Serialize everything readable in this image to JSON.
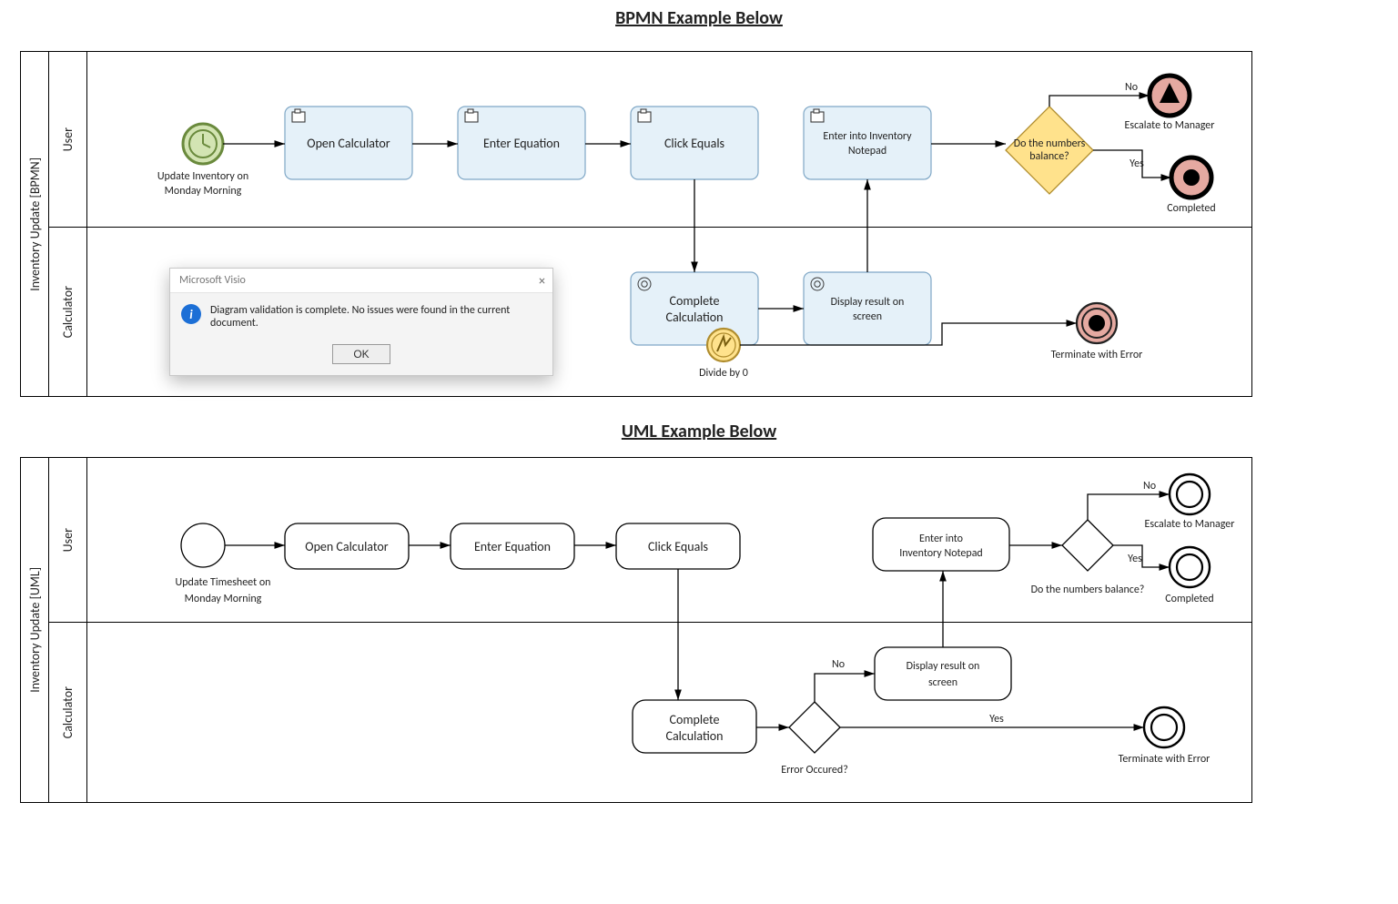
{
  "titles": {
    "bpmn": "BPMN Example Below",
    "uml": "UML Example Below"
  },
  "bpmn": {
    "pool": "Inventory Update [BPMN]",
    "lanes": {
      "user": "User",
      "calc": "Calculator"
    },
    "start_label": "Update Inventory on Monday Morning",
    "tasks": {
      "open_calc": "Open Calculator",
      "enter_eq": "Enter Equation",
      "click_equals": "Click Equals",
      "complete": "Complete Calculation",
      "display": "Display result on screen",
      "enter_inv": "Enter into Inventory Notepad"
    },
    "gateway": {
      "question_l1": "Do the numbers",
      "question_l2": "balance?",
      "yes": "Yes",
      "no": "No"
    },
    "events": {
      "divide0": "Divide by 0",
      "escalate": "Escalate to Manager",
      "completed": "Completed",
      "term_err": "Terminate with Error"
    }
  },
  "uml": {
    "pool": "Inventory Update [UML]",
    "lanes": {
      "user": "User",
      "calc": "Calculator"
    },
    "start_label": "Update Timesheet on Monday Morning",
    "tasks": {
      "open_calc": "Open Calculator",
      "enter_eq": "Enter Equation",
      "click_equals": "Click Equals",
      "complete": "Complete Calculation",
      "display": "Display result on screen",
      "enter_inv": "Enter into Inventory Notepad"
    },
    "gate_err": {
      "question": "Error Occured?",
      "yes": "Yes",
      "no": "No"
    },
    "gate_bal": {
      "question": "Do the numbers balance?",
      "yes": "Yes",
      "no": "No"
    },
    "events": {
      "escalate": "Escalate to Manager",
      "completed": "Completed",
      "term_err": "Terminate with Error"
    }
  },
  "dialog": {
    "title": "Microsoft Visio",
    "msg": "Diagram validation is complete. No issues were found in the current document.",
    "ok": "OK"
  }
}
